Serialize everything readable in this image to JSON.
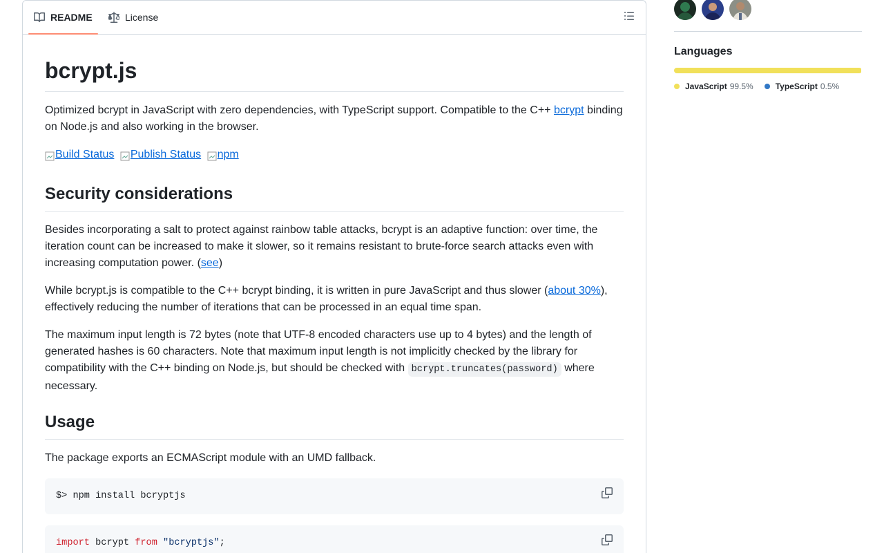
{
  "tabs": {
    "readme": "README",
    "license": "License"
  },
  "readme": {
    "title": "bcrypt.js",
    "intro": {
      "before": "Optimized bcrypt in JavaScript with zero dependencies, with TypeScript support. Compatible to the C++ ",
      "link": "bcrypt",
      "after": " binding on Node.js and also working in the browser."
    },
    "badges": [
      "Build Status",
      "Publish Status",
      "npm"
    ],
    "security_heading": "Security considerations",
    "security_p1": {
      "text": "Besides incorporating a salt to protect against rainbow table attacks, bcrypt is an adaptive function: over time, the iteration count can be increased to make it slower, so it remains resistant to brute-force search attacks even with increasing computation power. (",
      "link": "see",
      "after": ")"
    },
    "security_p2": {
      "text": "While bcrypt.js is compatible to the C++ bcrypt binding, it is written in pure JavaScript and thus slower (",
      "link": "about 30%",
      "after": "), effectively reducing the number of iterations that can be processed in an equal time span."
    },
    "security_p3": {
      "text": "The maximum input length is 72 bytes (note that UTF-8 encoded characters use up to 4 bytes) and the length of generated hashes is 60 characters. Note that maximum input length is not implicitly checked by the library for compatibility with the C++ binding on Node.js, but should be checked with ",
      "code": "bcrypt.truncates(password)",
      "after": " where necessary."
    },
    "usage_heading": "Usage",
    "usage_p": "The package exports an ECMAScript module with an UMD fallback.",
    "code1": "$> npm install bcryptjs",
    "code2": {
      "kw1": "import",
      "ident": " bcrypt ",
      "kw2": "from",
      "str": "\"bcryptjs\"",
      "end": ";"
    }
  },
  "sidebar": {
    "languages_heading": "Languages",
    "languages": [
      {
        "name": "JavaScript",
        "pct": "99.5%",
        "percent": 99.5,
        "color": "#f1e05a"
      },
      {
        "name": "TypeScript",
        "pct": "0.5%",
        "percent": 0.5,
        "color": "#3178c6"
      }
    ]
  }
}
